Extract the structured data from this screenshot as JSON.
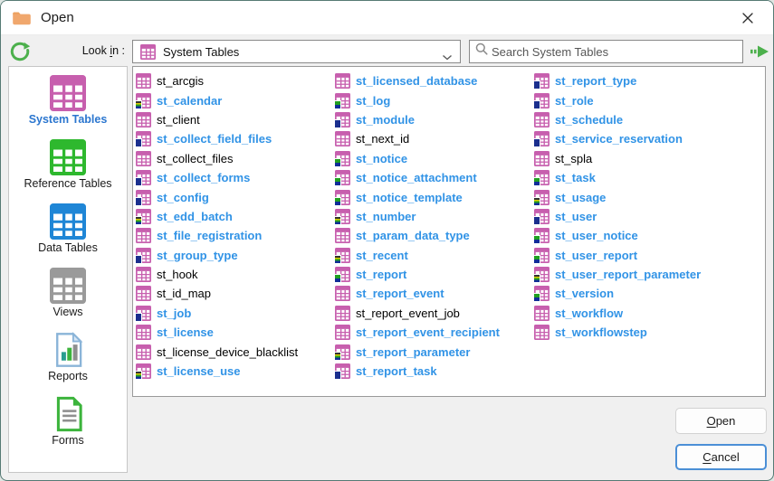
{
  "window": {
    "title": "Open"
  },
  "icons": {
    "title": "folder-icon",
    "refresh": "refresh-icon",
    "dropdown_table": "table-icon",
    "dropdown_chevron": "chevron-down-icon",
    "search": "search-icon",
    "search_go": "go-arrow-icon",
    "close": "close-icon",
    "sidebar_tables": "table-icon",
    "sidebar_reports": "report-chart-icon",
    "sidebar_forms": "form-document-icon"
  },
  "toolbar": {
    "look_in": {
      "pre": "Look ",
      "mn": "i",
      "post": "n :"
    },
    "dropdown_value": "System Tables",
    "search_placeholder": "Search System Tables"
  },
  "sidebar": {
    "items": [
      {
        "label": "System Tables",
        "type": "table",
        "color": "#c75fae",
        "selected": true
      },
      {
        "label": "Reference Tables",
        "type": "table",
        "color": "#2eb82e",
        "selected": false
      },
      {
        "label": "Data Tables",
        "type": "table",
        "color": "#1f86d6",
        "selected": false
      },
      {
        "label": "Views",
        "type": "table",
        "color": "#9a9a9a",
        "selected": false
      },
      {
        "label": "Reports",
        "type": "report",
        "color": "#8ab4d8",
        "selected": false
      },
      {
        "label": "Forms",
        "type": "form",
        "color": "#3cb43c",
        "selected": false
      }
    ]
  },
  "list": {
    "icon_color": "#c75fae",
    "columns": [
      [
        {
          "label": "st_arcgis",
          "bold": false,
          "badge": "none"
        },
        {
          "label": "st_calendar",
          "bold": true,
          "badge": "multi"
        },
        {
          "label": "st_client",
          "bold": false,
          "badge": "none"
        },
        {
          "label": "st_collect_field_files",
          "bold": true,
          "badge": "blue"
        },
        {
          "label": "st_collect_files",
          "bold": false,
          "badge": "none"
        },
        {
          "label": "st_collect_forms",
          "bold": true,
          "badge": "blue"
        },
        {
          "label": "st_config",
          "bold": true,
          "badge": "blue"
        },
        {
          "label": "st_edd_batch",
          "bold": true,
          "badge": "multi"
        },
        {
          "label": "st_file_registration",
          "bold": true,
          "badge": "none"
        },
        {
          "label": "st_group_type",
          "bold": true,
          "badge": "blue"
        },
        {
          "label": "st_hook",
          "bold": false,
          "badge": "none"
        },
        {
          "label": "st_id_map",
          "bold": false,
          "badge": "none"
        },
        {
          "label": "st_job",
          "bold": true,
          "badge": "blue"
        },
        {
          "label": "st_license",
          "bold": true,
          "badge": "none"
        },
        {
          "label": "st_license_device_blacklist",
          "bold": false,
          "badge": "none"
        },
        {
          "label": "st_license_use",
          "bold": true,
          "badge": "multi"
        }
      ],
      [
        {
          "label": "st_licensed_database",
          "bold": true,
          "badge": "none"
        },
        {
          "label": "st_log",
          "bold": true,
          "badge": "green"
        },
        {
          "label": "st_module",
          "bold": true,
          "badge": "blue"
        },
        {
          "label": "st_next_id",
          "bold": false,
          "badge": "none"
        },
        {
          "label": "st_notice",
          "bold": true,
          "badge": "green"
        },
        {
          "label": "st_notice_attachment",
          "bold": true,
          "badge": "green"
        },
        {
          "label": "st_notice_template",
          "bold": true,
          "badge": "green"
        },
        {
          "label": "st_number",
          "bold": true,
          "badge": "multi"
        },
        {
          "label": "st_param_data_type",
          "bold": true,
          "badge": "none"
        },
        {
          "label": "st_recent",
          "bold": true,
          "badge": "multi"
        },
        {
          "label": "st_report",
          "bold": true,
          "badge": "green"
        },
        {
          "label": "st_report_event",
          "bold": true,
          "badge": "none"
        },
        {
          "label": "st_report_event_job",
          "bold": false,
          "badge": "none"
        },
        {
          "label": "st_report_event_recipient",
          "bold": true,
          "badge": "none"
        },
        {
          "label": "st_report_parameter",
          "bold": true,
          "badge": "multi"
        },
        {
          "label": "st_report_task",
          "bold": true,
          "badge": "blue"
        }
      ],
      [
        {
          "label": "st_report_type",
          "bold": true,
          "badge": "blue"
        },
        {
          "label": "st_role",
          "bold": true,
          "badge": "blue"
        },
        {
          "label": "st_schedule",
          "bold": true,
          "badge": "none"
        },
        {
          "label": "st_service_reservation",
          "bold": true,
          "badge": "blue"
        },
        {
          "label": "st_spla",
          "bold": false,
          "badge": "none"
        },
        {
          "label": "st_task",
          "bold": true,
          "badge": "green"
        },
        {
          "label": "st_usage",
          "bold": true,
          "badge": "multi"
        },
        {
          "label": "st_user",
          "bold": true,
          "badge": "blue"
        },
        {
          "label": "st_user_notice",
          "bold": true,
          "badge": "green"
        },
        {
          "label": "st_user_report",
          "bold": true,
          "badge": "green"
        },
        {
          "label": "st_user_report_parameter",
          "bold": true,
          "badge": "multi"
        },
        {
          "label": "st_version",
          "bold": true,
          "badge": "green"
        },
        {
          "label": "st_workflow",
          "bold": true,
          "badge": "none"
        },
        {
          "label": "st_workflowstep",
          "bold": true,
          "badge": "none"
        }
      ]
    ]
  },
  "buttons": {
    "open": {
      "mn": "O",
      "post": "pen"
    },
    "cancel": {
      "mn": "C",
      "post": "ancel"
    }
  },
  "colors": {
    "link_blue": "#3193e6",
    "selected_blue": "#2b76cf",
    "magenta": "#c75fae",
    "green": "#2eb82e",
    "blue": "#1f86d6",
    "gray": "#9a9a9a",
    "accent_green": "#4cb04c",
    "window_border": "#567a74"
  }
}
